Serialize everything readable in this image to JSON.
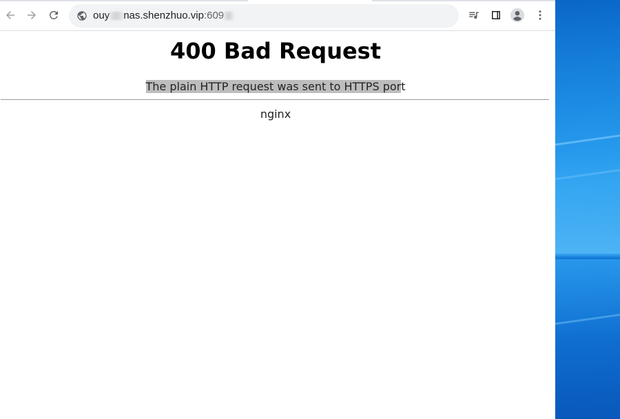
{
  "browser": {
    "toolbar": {
      "back_icon": "arrow-left-icon",
      "forward_icon": "arrow-right-icon",
      "reload_icon": "reload-icon",
      "site_info_icon": "globe-icon",
      "media_icon": "media-playlist-icon",
      "side_panel_icon": "side-panel-icon",
      "profile_icon": "account-icon",
      "menu_icon": "more-vert-icon"
    },
    "address_bar": {
      "url_start": "ouy",
      "url_host": "nas.shenzhuo.vip",
      "url_port": ":609"
    }
  },
  "page": {
    "title": "400 Bad Request",
    "message": {
      "selected": "The plain HTTP request was sent to HTTPS por",
      "rest": "t"
    },
    "server": "nginx"
  },
  "colors": {
    "selection": "#bdbdbd",
    "omnibox_bg": "#f1f3f4",
    "desktop_blue": "#0a78d8"
  }
}
